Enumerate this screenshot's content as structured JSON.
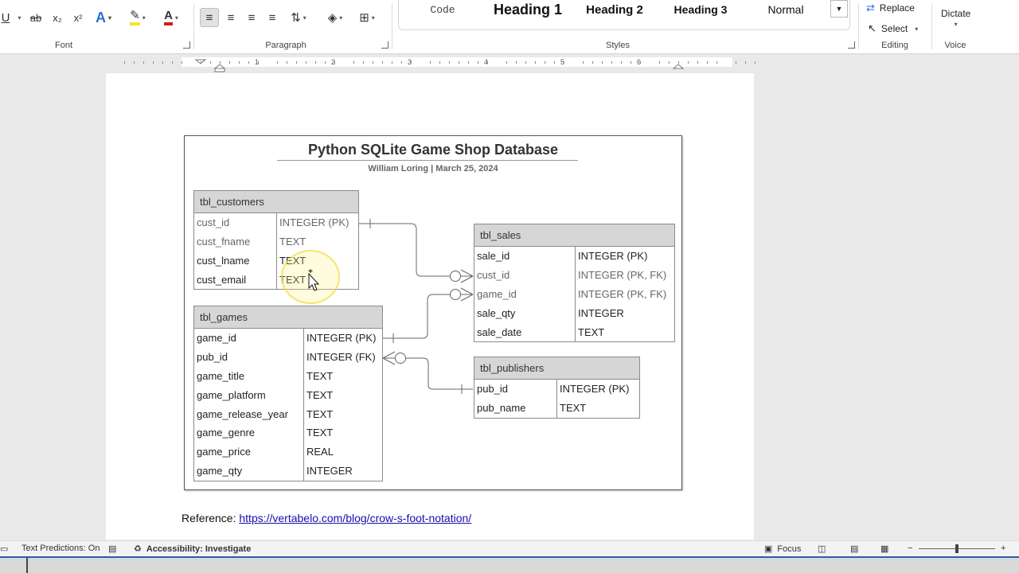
{
  "ribbon": {
    "font_group": {
      "label": "Font",
      "underline": "U",
      "strike": "ab",
      "subscript": "x₂",
      "superscript": "x²",
      "text_effects": "A",
      "highlight": "✎",
      "font_color": "A"
    },
    "paragraph_group": {
      "label": "Paragraph"
    },
    "styles_group": {
      "label": "Styles",
      "items": [
        "Code",
        "Heading 1",
        "Heading 2",
        "Heading 3",
        "Normal"
      ]
    },
    "editing_group": {
      "label": "Editing",
      "replace": "Replace",
      "select": "Select"
    },
    "voice_group": {
      "label": "Voice",
      "dictate": "Dictate"
    }
  },
  "ruler": {
    "numbers": [
      "1",
      "2",
      "3",
      "4",
      "5",
      "6"
    ]
  },
  "diagram": {
    "title": "Python SQLite Game Shop Database",
    "subtitle": "William Loring  |  March 25, 2024",
    "tables": {
      "customers": {
        "name": "tbl_customers",
        "rows": [
          {
            "field": "cust_id",
            "type": "INTEGER (PK)"
          },
          {
            "field": "cust_fname",
            "type": "TEXT"
          },
          {
            "field": "cust_lname",
            "type": "TEXT"
          },
          {
            "field": "cust_email",
            "type": "TEXT"
          }
        ]
      },
      "games": {
        "name": "tbl_games",
        "rows": [
          {
            "field": "game_id",
            "type": "INTEGER (PK)"
          },
          {
            "field": "pub_id",
            "type": "INTEGER (FK)"
          },
          {
            "field": "game_title",
            "type": "TEXT"
          },
          {
            "field": "game_platform",
            "type": "TEXT"
          },
          {
            "field": "game_release_year",
            "type": "TEXT"
          },
          {
            "field": "game_genre",
            "type": "TEXT"
          },
          {
            "field": "game_price",
            "type": "REAL"
          },
          {
            "field": "game_qty",
            "type": "INTEGER"
          }
        ]
      },
      "sales": {
        "name": "tbl_sales",
        "rows": [
          {
            "field": "sale_id",
            "type": "INTEGER (PK)"
          },
          {
            "field": "cust_id",
            "type": "INTEGER (PK, FK)"
          },
          {
            "field": "game_id",
            "type": "INTEGER (PK, FK)"
          },
          {
            "field": "sale_qty",
            "type": "INTEGER"
          },
          {
            "field": "sale_date",
            "type": "TEXT"
          }
        ]
      },
      "publishers": {
        "name": "tbl_publishers",
        "rows": [
          {
            "field": "pub_id",
            "type": "INTEGER (PK)"
          },
          {
            "field": "pub_name",
            "type": "TEXT"
          }
        ]
      }
    }
  },
  "reference": {
    "label": "Reference:",
    "link": "https://vertabelo.com/blog/crow-s-foot-notation/"
  },
  "status": {
    "text_predictions": "Text Predictions: On",
    "accessibility": "Accessibility: Investigate",
    "focus": "Focus",
    "zoom_minus": "−",
    "zoom_plus": "+"
  }
}
